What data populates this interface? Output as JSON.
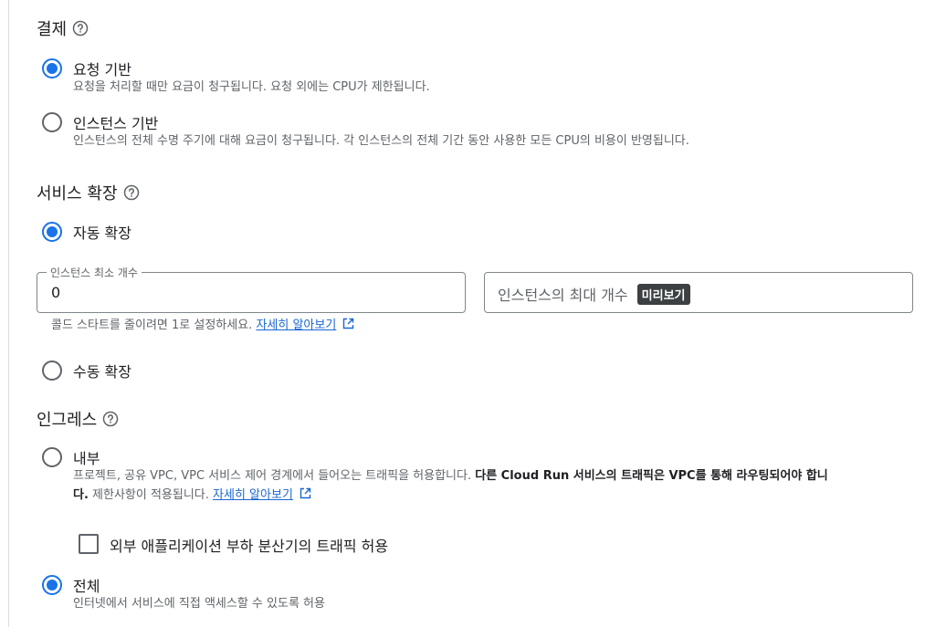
{
  "billing": {
    "title": "결제",
    "options": [
      {
        "label": "요청 기반",
        "desc": "요청을 처리할 때만 요금이 청구됩니다. 요청 외에는 CPU가 제한됩니다.",
        "selected": true
      },
      {
        "label": "인스턴스 기반",
        "desc": "인스턴스의 전체 수명 주기에 대해 요금이 청구됩니다. 각 인스턴스의 전체 기간 동안 사용한 모든 CPU의 비용이 반영됩니다.",
        "selected": false
      }
    ]
  },
  "scaling": {
    "title": "서비스 확장",
    "auto_label": "자동 확장",
    "min_instances": {
      "label": "인스턴스 최소 개수",
      "value": "0"
    },
    "max_instances": {
      "placeholder": "인스턴스의 최대 개수",
      "badge": "미리보기"
    },
    "hint": "콜드 스타트를 줄이려면 1로 설정하세요.",
    "hint_link": "자세히 알아보기",
    "manual_label": "수동 확장"
  },
  "ingress": {
    "title": "인그레스",
    "internal": {
      "label": "내부",
      "desc_part1": "프로젝트, 공유 VPC, VPC 서비스 제어 경계에서 들어오는 트래픽을 허용합니다. ",
      "desc_bold_line1": "다른 Cloud Run 서비스의 트래픽은 VPC를 통해 라우팅되어야 합니",
      "desc_bold_line2": "다.",
      "desc_part2": " 제한사항이 적용됩니다.",
      "link": "자세히 알아보기"
    },
    "lb_checkbox_label": "외부 애플리케이션 부하 분산기의 트래픽 허용",
    "all": {
      "label": "전체",
      "desc": "인터넷에서 서비스에 직접 액세스할 수 있도록 허용"
    }
  },
  "colors": {
    "accent": "#1a73e8",
    "link": "#1967d2",
    "badge_bg": "#3c4043"
  },
  "icons": {
    "help": "help-circle-icon",
    "external": "open-in-new-icon"
  }
}
